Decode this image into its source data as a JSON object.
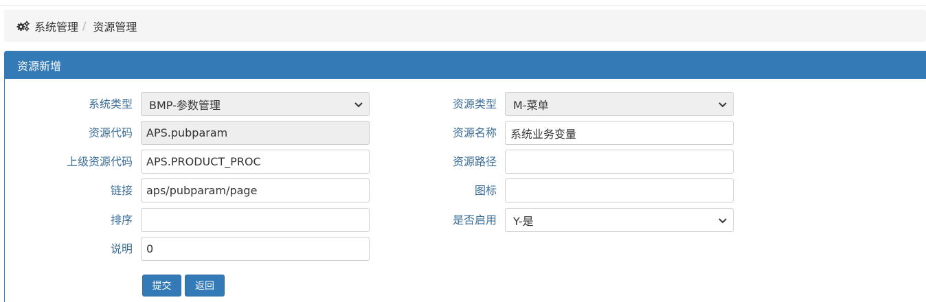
{
  "breadcrumb": {
    "icon": "gears-icon",
    "root": "系统管理",
    "separator": "/",
    "current": "资源管理"
  },
  "panel": {
    "title": "资源新增",
    "header_color": "#337ab7"
  },
  "form": {
    "system_type": {
      "label": "系统类型",
      "value": "BMP-参数管理"
    },
    "resource_type": {
      "label": "资源类型",
      "value": "M-菜单"
    },
    "resource_code": {
      "label": "资源代码",
      "value": "APS.pubparam"
    },
    "resource_name": {
      "label": "资源名称",
      "value": "系统业务变量"
    },
    "parent_code": {
      "label": "上级资源代码",
      "value": "APS.PRODUCT_PROC"
    },
    "resource_path": {
      "label": "资源路径",
      "value": ""
    },
    "link": {
      "label": "链接",
      "value": "aps/pubparam/page"
    },
    "icon": {
      "label": "图标",
      "value": ""
    },
    "sort": {
      "label": "排序",
      "value": ""
    },
    "enabled": {
      "label": "是否启用",
      "value": "Y-是"
    },
    "description": {
      "label": "说明",
      "value": "0"
    }
  },
  "buttons": {
    "submit": "提交",
    "back": "返回"
  }
}
